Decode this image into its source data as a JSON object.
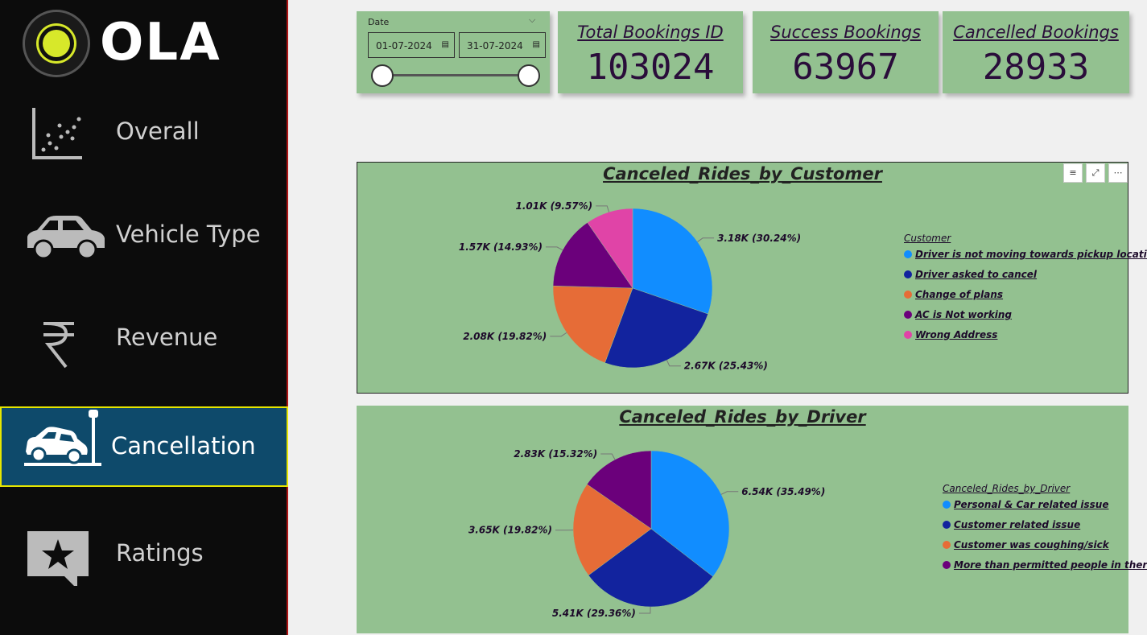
{
  "brand": {
    "name": "OLA"
  },
  "nav": {
    "items": [
      {
        "label": "Overall",
        "icon": "scatter-chart-icon"
      },
      {
        "label": "Vehicle Type",
        "icon": "car-icon"
      },
      {
        "label": "Revenue",
        "icon": "rupee-icon"
      },
      {
        "label": "Cancellation",
        "icon": "car-crash-icon",
        "active": true
      },
      {
        "label": "Ratings",
        "icon": "star-rating-icon"
      }
    ]
  },
  "date_filter": {
    "label": "Date",
    "start": "01-07-2024",
    "end": "31-07-2024",
    "range": [
      0,
      1
    ]
  },
  "kpis": [
    {
      "title": "Total Bookings ID",
      "value": "103024"
    },
    {
      "title": "Success Bookings",
      "value": "63967"
    },
    {
      "title": "Cancelled Bookings",
      "value": "28933"
    }
  ],
  "visual_header": {
    "filter_icon": "filter-icon",
    "focus_icon": "focus-mode-icon",
    "more_icon": "more-options-icon"
  },
  "chart_data": [
    {
      "type": "pie",
      "title": "Canceled_Rides_by_Customer",
      "legend_title": "Customer",
      "legend_position": "right",
      "categories": [
        "Driver is not moving towards pickup location",
        "Driver asked to cancel",
        "Change of plans",
        "AC is Not working",
        "Wrong Address"
      ],
      "values": [
        3180,
        2670,
        2080,
        1570,
        1010
      ],
      "percents": [
        30.24,
        25.43,
        19.82,
        14.93,
        9.57
      ],
      "data_labels": [
        "3.18K (30.24%)",
        "2.67K (25.43%)",
        "2.08K (19.82%)",
        "1.57K (14.93%)",
        "1.01K (9.57%)"
      ],
      "colors": [
        "#118dff",
        "#12239e",
        "#e66c37",
        "#6b007b",
        "#e044a7"
      ]
    },
    {
      "type": "pie",
      "title": "Canceled_Rides_by_Driver",
      "legend_title": "Canceled_Rides_by_Driver",
      "legend_position": "right",
      "categories": [
        "Personal & Car related issue",
        "Customer related issue",
        "Customer was coughing/sick",
        "More than permitted people in there"
      ],
      "values": [
        6540,
        5410,
        3650,
        2830
      ],
      "percents": [
        35.49,
        29.36,
        19.82,
        15.32
      ],
      "data_labels": [
        "6.54K (35.49%)",
        "5.41K (29.36%)",
        "3.65K (19.82%)",
        "2.83K (15.32%)"
      ],
      "colors": [
        "#118dff",
        "#12239e",
        "#e66c37",
        "#6b007b"
      ]
    }
  ]
}
